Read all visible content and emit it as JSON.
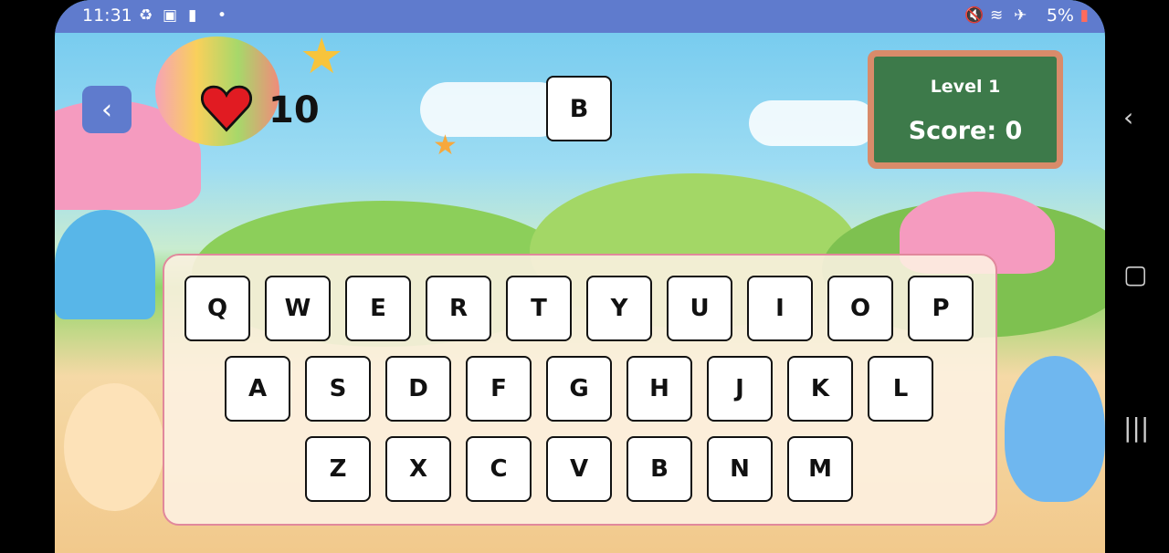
{
  "status_bar": {
    "time": "11:31",
    "battery": "5%",
    "icons": [
      "sync-icon",
      "image-icon",
      "battery-saver-icon",
      "dot-icon",
      "mute-icon",
      "wifi-icon",
      "airplane-icon",
      "battery-icon"
    ]
  },
  "game": {
    "lives": "10",
    "target_letter": "B",
    "level_label": "Level 1",
    "score_label": "Score: 0"
  },
  "keyboard": {
    "row1": [
      "Q",
      "W",
      "E",
      "R",
      "T",
      "Y",
      "U",
      "I",
      "O",
      "P"
    ],
    "row2": [
      "A",
      "S",
      "D",
      "F",
      "G",
      "H",
      "J",
      "K",
      "L"
    ],
    "row3": [
      "Z",
      "X",
      "C",
      "V",
      "B",
      "N",
      "M"
    ]
  },
  "colors": {
    "accent": "#5f7bcd",
    "board": "#3d7a4a",
    "board_frame": "#d98b6a",
    "heart": "#e11b22",
    "keyboard_border": "#e1889c"
  }
}
